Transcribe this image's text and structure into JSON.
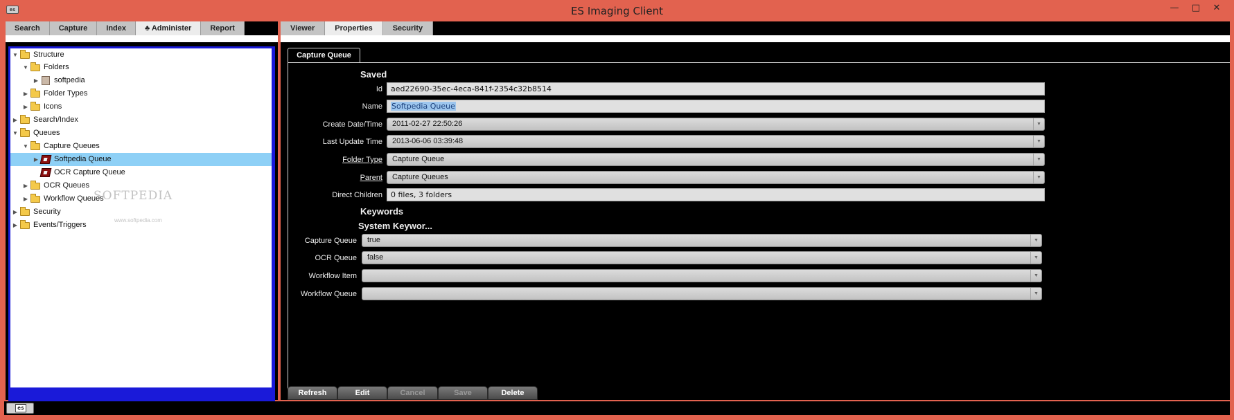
{
  "window": {
    "title": "ES Imaging Client",
    "minimize": "—",
    "maximize": "□",
    "close": "✕",
    "app_icon_text": "es"
  },
  "left_tabs": [
    "Search",
    "Capture",
    "Index",
    "♣ Administer",
    "Report"
  ],
  "tree": [
    {
      "label": "Structure",
      "twisty": "▼",
      "icon": "folder"
    },
    {
      "label": "Folders",
      "twisty": "▼",
      "icon": "folder"
    },
    {
      "label": "softpedia",
      "twisty": "▶",
      "icon": "building"
    },
    {
      "label": "Folder Types",
      "twisty": "▶",
      "icon": "folder"
    },
    {
      "label": "Icons",
      "twisty": "▶",
      "icon": "folder"
    },
    {
      "label": "Search/Index",
      "twisty": "▶",
      "icon": "folder"
    },
    {
      "label": "Queues",
      "twisty": "▼",
      "icon": "folder"
    },
    {
      "label": "Capture Queues",
      "twisty": "▼",
      "icon": "folder"
    },
    {
      "label": "Softpedia Queue",
      "twisty": "▶",
      "icon": "queue",
      "selected": true
    },
    {
      "label": "OCR Capture Queue",
      "twisty": "",
      "icon": "queue"
    },
    {
      "label": "OCR Queues",
      "twisty": "▶",
      "icon": "folder"
    },
    {
      "label": "Workflow Queues",
      "twisty": "▶",
      "icon": "folder"
    },
    {
      "label": "Security",
      "twisty": "▶",
      "icon": "folder"
    },
    {
      "label": "Events/Triggers",
      "twisty": "▶",
      "icon": "folder"
    }
  ],
  "watermark": {
    "text": "SOFTPEDIA",
    "sub": "www.softpedia.com"
  },
  "right_tabs": [
    "Viewer",
    "Properties",
    "Security"
  ],
  "inner_tab": "Capture Queue",
  "saved": {
    "heading": "Saved",
    "id_label": "Id",
    "id_value": "aed22690-35ec-4eca-841f-2354c32b8514",
    "name_label": "Name",
    "name_value": "Softpedia Queue",
    "create_label": "Create Date/Time",
    "create_value": "2011-02-27 22:50:26",
    "update_label": "Last Update Time",
    "update_value": "2013-06-06 03:39:48",
    "folder_type_label": "Folder Type",
    "folder_type_value": "Capture Queue",
    "parent_label": "Parent",
    "parent_value": "Capture Queues",
    "children_label": "Direct Children",
    "children_value": "0 files, 3 folders"
  },
  "keywords_heading": "Keywords",
  "system_keywords_heading": "System Keywor...",
  "system_keywords": {
    "capture_label": "Capture Queue",
    "capture_value": "true",
    "ocr_label": "OCR Queue",
    "ocr_value": "false",
    "wf_item_label": "Workflow Item",
    "wf_item_value": "",
    "wf_queue_label": "Workflow Queue",
    "wf_queue_value": ""
  },
  "buttons": {
    "refresh": "Refresh",
    "edit": "Edit",
    "cancel": "Cancel",
    "save": "Save",
    "delete": "Delete"
  },
  "status": {
    "logo_text": "es"
  }
}
